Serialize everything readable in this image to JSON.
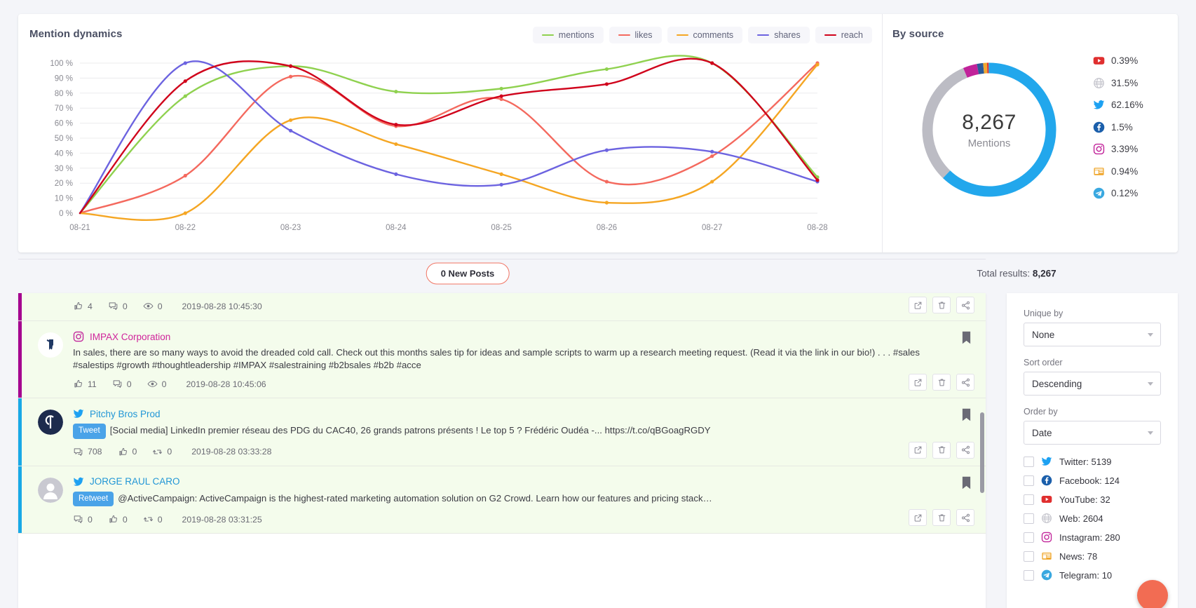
{
  "dynamics": {
    "title": "Mention dynamics",
    "legend": [
      {
        "label": "mentions",
        "color": "#8fd14f"
      },
      {
        "label": "likes",
        "color": "#f4695e"
      },
      {
        "label": "comments",
        "color": "#f5a623"
      },
      {
        "label": "shares",
        "color": "#6c63e0"
      },
      {
        "label": "reach",
        "color": "#d0021b"
      }
    ]
  },
  "chart_data": {
    "type": "line",
    "title": "Mention dynamics",
    "xlabel": "",
    "ylabel": "%",
    "ylim": [
      0,
      100
    ],
    "grid": true,
    "legend_position": "top-right",
    "x": [
      "08-21",
      "08-22",
      "08-23",
      "08-24",
      "08-25",
      "08-26",
      "08-27",
      "08-28"
    ],
    "yticks": [
      "0 %",
      "10 %",
      "20 %",
      "30 %",
      "40 %",
      "50 %",
      "60 %",
      "70 %",
      "80 %",
      "90 %",
      "100 %"
    ],
    "series": [
      {
        "name": "mentions",
        "color": "#8fd14f",
        "values": [
          0,
          78,
          98,
          81,
          83,
          96,
          100,
          24
        ]
      },
      {
        "name": "likes",
        "color": "#f4695e",
        "values": [
          0,
          25,
          91,
          58,
          76,
          21,
          38,
          100
        ]
      },
      {
        "name": "comments",
        "color": "#f5a623",
        "values": [
          0,
          0,
          62,
          46,
          26,
          7,
          21,
          99
        ]
      },
      {
        "name": "shares",
        "color": "#6c63e0",
        "values": [
          0,
          100,
          55,
          26,
          19,
          42,
          41,
          21
        ]
      },
      {
        "name": "reach",
        "color": "#d0021b",
        "values": [
          0,
          88,
          98,
          59,
          78,
          86,
          100,
          22
        ]
      }
    ]
  },
  "by_source": {
    "title": "By source",
    "total": "8,267",
    "total_label": "Mentions",
    "donut": [
      {
        "name": "twitter",
        "color": "#22a7ec",
        "pct": 62.16
      },
      {
        "name": "web",
        "color": "#bcbcc4",
        "pct": 31.5
      },
      {
        "name": "instagram",
        "color": "#c1239a",
        "pct": 3.39
      },
      {
        "name": "facebook",
        "color": "#2b5b9a",
        "pct": 1.5
      },
      {
        "name": "news",
        "color": "#f0a830",
        "pct": 0.94
      },
      {
        "name": "youtube",
        "color": "#e02f2f",
        "pct": 0.39
      },
      {
        "name": "telegram",
        "color": "#39a8e0",
        "pct": 0.12
      }
    ],
    "legend": [
      {
        "icon": "youtube-icon",
        "pct": "0.39%"
      },
      {
        "icon": "web-icon",
        "pct": "31.5%"
      },
      {
        "icon": "twitter-icon",
        "pct": "62.16%"
      },
      {
        "icon": "facebook-icon",
        "pct": "1.5%"
      },
      {
        "icon": "instagram-icon",
        "pct": "3.39%"
      },
      {
        "icon": "news-icon",
        "pct": "0.94%"
      },
      {
        "icon": "telegram-icon",
        "pct": "0.12%"
      }
    ]
  },
  "feed_bar": {
    "new_posts": "0 New Posts",
    "total_results_label": "Total results:",
    "total_results_value": "8,267"
  },
  "posts": [
    {
      "accent": "#a5008f",
      "network": "",
      "author": "",
      "text": "",
      "tag": "",
      "partial": true,
      "meta": [
        {
          "icon": "thumbs-up-icon",
          "value": "4"
        },
        {
          "icon": "comment-icon",
          "value": "0"
        },
        {
          "icon": "eye-icon",
          "value": "0"
        }
      ],
      "date": "2019-08-28 10:45:30"
    },
    {
      "accent": "#a5008f",
      "network": "instagram",
      "author": "IMPAX Corporation",
      "author_color": "#d0249b",
      "text": "In sales, there are so many ways to avoid the dreaded cold call. Check out this months sales tip for ideas and sample scripts to warm up a research meeting request.   (Read it via the link in our bio!)   .   .   .   #sales #salestips #growth #thoughtleadership #IMPAX #salestraining #b2bsales #b2b #acce",
      "tag": "",
      "partial": false,
      "meta": [
        {
          "icon": "thumbs-up-icon",
          "value": "11"
        },
        {
          "icon": "comment-icon",
          "value": "0"
        },
        {
          "icon": "eye-icon",
          "value": "0"
        }
      ],
      "date": "2019-08-28 10:45:06"
    },
    {
      "accent": "#19a9e6",
      "network": "twitter",
      "author": "Pitchy Bros Prod",
      "author_color": "#2196d6",
      "tag": "Tweet",
      "text": "[Social media] LinkedIn premier réseau des PDG du CAC40, 26 grands patrons présents ! Le top 5 ? Frédéric Oudéa -... https://t.co/qBGoagRGDY",
      "partial": false,
      "meta": [
        {
          "icon": "retweet-box-icon",
          "value": "708"
        },
        {
          "icon": "thumbs-up-icon",
          "value": "0"
        },
        {
          "icon": "retweet-icon",
          "value": "0"
        }
      ],
      "date": "2019-08-28 03:33:28"
    },
    {
      "accent": "#19a9e6",
      "network": "twitter",
      "author": "JORGE RAUL CARO",
      "author_color": "#2196d6",
      "tag": "Retweet",
      "text": "@ActiveCampaign: ActiveCampaign is the highest-rated marketing automation solution on G2 Crowd. Learn how our features and pricing stack…",
      "partial": false,
      "meta": [
        {
          "icon": "retweet-box-icon",
          "value": "0"
        },
        {
          "icon": "thumbs-up-icon",
          "value": "0"
        },
        {
          "icon": "retweet-icon",
          "value": "0"
        }
      ],
      "date": "2019-08-28 03:31:25"
    }
  ],
  "filters": {
    "unique_by": {
      "label": "Unique by",
      "value": "None"
    },
    "sort_order": {
      "label": "Sort order",
      "value": "Descending"
    },
    "order_by": {
      "label": "Order by",
      "value": "Date"
    },
    "networks": [
      {
        "icon": "twitter-icon",
        "label": "Twitter: 5139"
      },
      {
        "icon": "facebook-icon",
        "label": "Facebook: 124"
      },
      {
        "icon": "youtube-icon",
        "label": "YouTube: 32"
      },
      {
        "icon": "web-icon",
        "label": "Web: 2604"
      },
      {
        "icon": "instagram-icon",
        "label": "Instagram: 280"
      },
      {
        "icon": "news-icon",
        "label": "News: 78"
      },
      {
        "icon": "telegram-icon",
        "label": "Telegram: 10"
      }
    ]
  }
}
